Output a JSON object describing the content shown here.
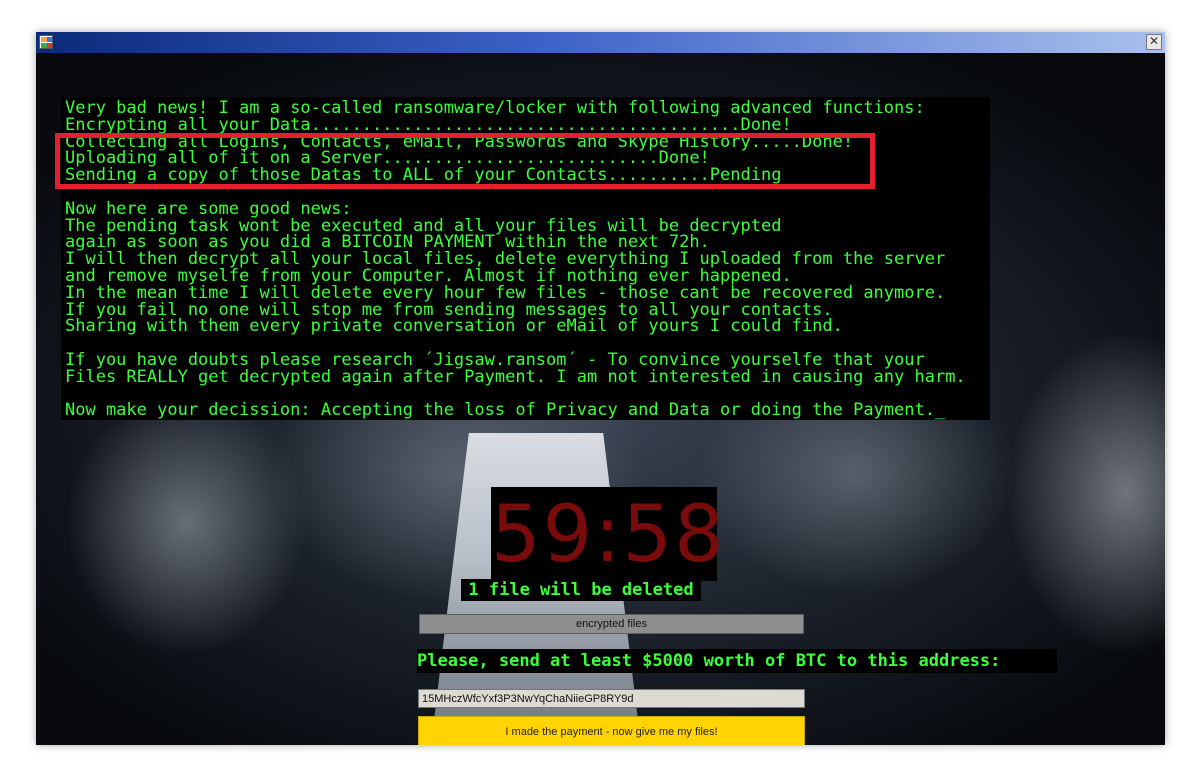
{
  "window": {
    "icon": "app-icon",
    "close_label": "✕",
    "titlebar_colors": [
      "#0a2a7a",
      "#a9c1ec"
    ]
  },
  "message": {
    "lines": [
      "Very bad news! I am a so-called ransomware/locker with following advanced functions:",
      "Encrypting all your Data..........................................Done!",
      "Collecting all Logins, Contacts, eMail, Passwords and Skype History.....Done!",
      "Uploading all of it on a Server...........................Done!",
      "Sending a copy of those Datas to ALL of your Contacts..........Pending",
      "",
      "Now here are some good news:",
      "The pending task wont be executed and all your files will be decrypted",
      "again as soon as you did a BITCOIN PAYMENT within the next 72h.",
      "I will then decrypt all your local files, delete everything I uploaded from the server",
      "and remove myselfe from your Computer. Almost if nothing ever happened.",
      "In the mean time I will delete every hour few files - those cant be recovered anymore.",
      "If you fail no one will stop me from sending messages to all your contacts.",
      "Sharing with them every private conversation or eMail of yours I could find.",
      "",
      "If you have doubts please research ´Jigsaw.ransom´ - To convince yourselfe that your",
      "Files REALLY get decrypted again after Payment. I am not interested in causing any harm.",
      "",
      "Now make your decission: Accepting the loss of Privacy and Data or doing the Payment._"
    ]
  },
  "timer": {
    "value": "59:58",
    "deleted_label": "1 file will be deleted"
  },
  "encrypted_files_button": "encrypted files",
  "btc_instruction": "Please, send at least $5000 worth of BTC to this address:",
  "btc_address": "15MHczWfcYxf3P3NwYqChaNiieGP8RY9d",
  "payment_button": "I made the payment - now give me my files!",
  "colors": {
    "terminal_text": "#3aff3a",
    "highlight": "#e5202e",
    "timer": "#7a0b0b",
    "pay_button": "#ffd400"
  }
}
